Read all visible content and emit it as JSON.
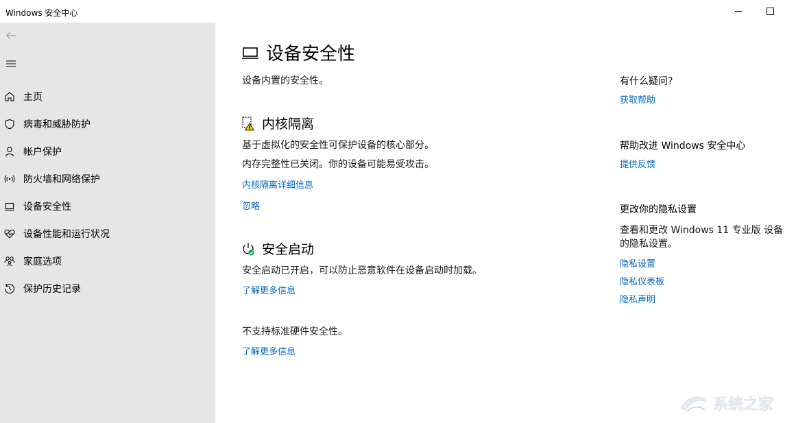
{
  "window": {
    "title": "Windows 安全中心"
  },
  "sidebar": {
    "items": [
      {
        "label": "主页",
        "icon": "home-icon"
      },
      {
        "label": "病毒和威胁防护",
        "icon": "shield-icon"
      },
      {
        "label": "帐户保护",
        "icon": "person-icon"
      },
      {
        "label": "防火墙和网络保护",
        "icon": "wifi-signal-icon"
      },
      {
        "label": "设备安全性",
        "icon": "laptop-icon"
      },
      {
        "label": "设备性能和运行状况",
        "icon": "heart-pulse-icon"
      },
      {
        "label": "家庭选项",
        "icon": "family-icon"
      },
      {
        "label": "保护历史记录",
        "icon": "history-icon"
      }
    ]
  },
  "main": {
    "title": "设备安全性",
    "subtitle": "设备内置的安全性。",
    "core_isolation": {
      "title": "内核隔离",
      "description": "基于虚拟化的安全性可保护设备的核心部分。",
      "warning": "内存完整性已关闭。你的设备可能易受攻击。",
      "details_link": "内核隔离详细信息",
      "ignore_link": "忽略"
    },
    "secure_boot": {
      "title": "安全启动",
      "description": "安全启动已开启，可以防止恶意软件在设备启动时加载。",
      "learn_more": "了解更多信息"
    },
    "hardware": {
      "text": "不支持标准硬件安全性。",
      "learn_more": "了解更多信息"
    }
  },
  "right_panel": {
    "question_heading": "有什么疑问?",
    "get_help": "获取帮助",
    "improve_heading": "帮助改进 Windows 安全中心",
    "feedback": "提供反馈",
    "privacy_heading": "更改你的隐私设置",
    "privacy_text": "查看和更改 Windows 11 专业版 设备的隐私设置。",
    "privacy_settings": "隐私设置",
    "privacy_dashboard": "隐私仪表板",
    "privacy_statement": "隐私声明"
  },
  "watermark": {
    "text": "系统之家"
  },
  "colors": {
    "link": "#0067c0",
    "sidebar_bg": "#e6e6e6",
    "warning": "#f2c200",
    "ok": "#16a34a"
  }
}
